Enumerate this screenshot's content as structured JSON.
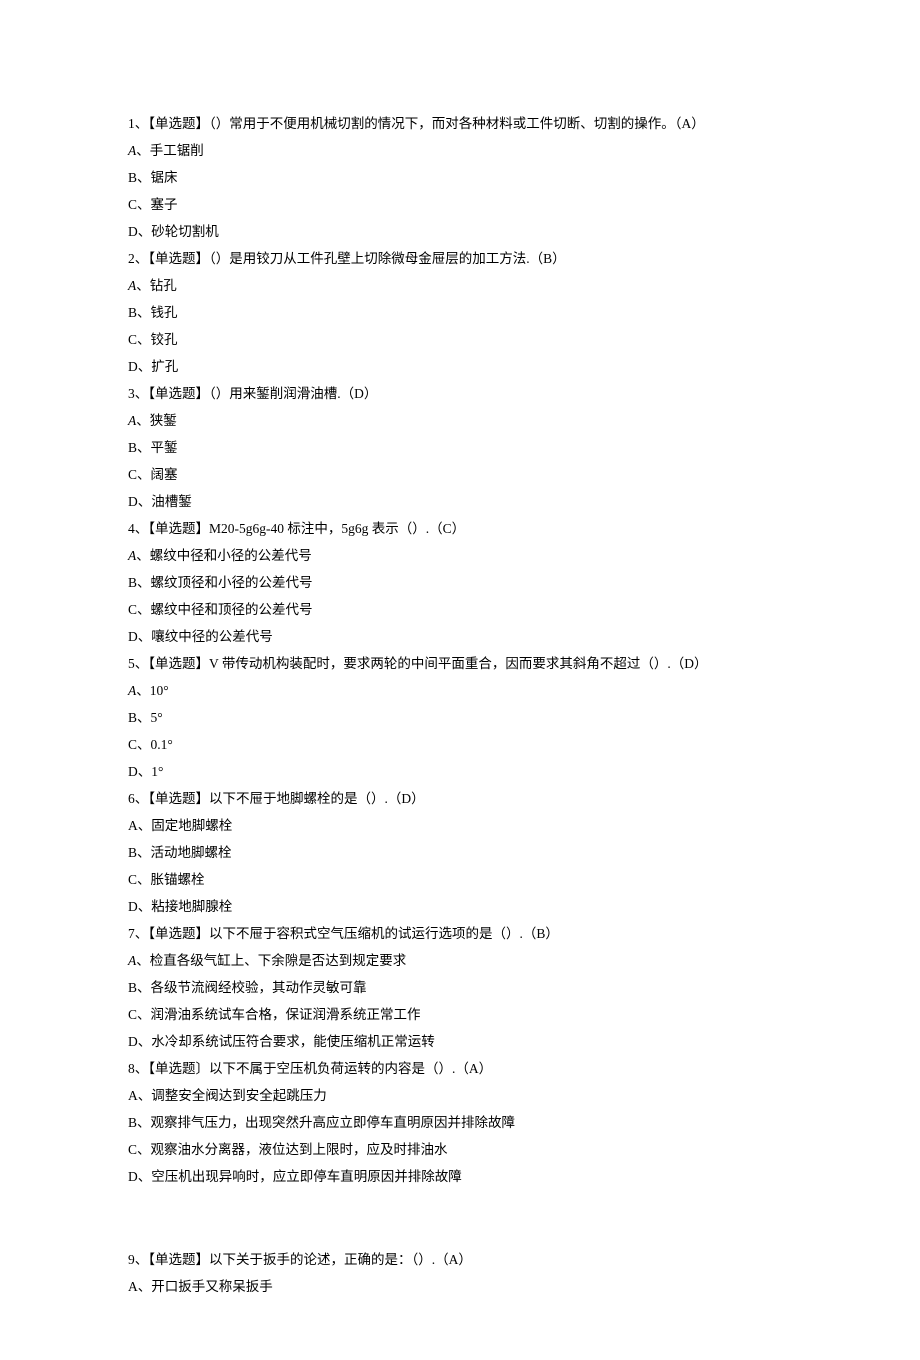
{
  "q1": {
    "stem": "1、【单选题】（）常用于不便用机械切割的情况下，而对各种材料或工件切断、切割的操作。（A）",
    "a": "、手工锯削",
    "b": "B、锯床",
    "c": "C、塞子",
    "d": "D、砂轮切割机"
  },
  "q2": {
    "stem": "2、【单选题】（）是用铰刀从工件孔壁上切除微母金屉层的加工方法.（B）",
    "a": "、钻孔",
    "b": "B、钱孔",
    "c": "C、铰孔",
    "d": "D、扩孔"
  },
  "q3": {
    "stem": "3、【单选题】（）用来錾削润滑油槽.（D）",
    "a": "、狭錾",
    "b": "B、平錾",
    "c": "C、阔塞",
    "d": "D、油槽錾"
  },
  "q4": {
    "stem": "4、【单选题】M20-5g6g-40 标注中，5g6g 表示（）.（C）",
    "a": "、螺纹中径和小径的公差代号",
    "b": "B、螺纹顶径和小径的公差代号",
    "c": "C、螺纹中径和顶径的公差代号",
    "d": "D、嚷纹中径的公差代号"
  },
  "q5": {
    "stem": "5、【单选题】V 带传动机构装配时，要求两轮的中间平面重合，因而要求其斜角不超过（）.（D）",
    "a": "、10°",
    "b": "B、5°",
    "c": "C、0.1°",
    "d": "D、1°"
  },
  "q6": {
    "stem": "6、【单选题】以下不屉于地脚螺栓的是（）.（D）",
    "a": "A、固定地脚螺栓",
    "b": "B、活动地脚螺栓",
    "c": "C、胀锚螺栓",
    "d": "D、粘接地脚腺栓"
  },
  "q7": {
    "stem": "7、【单选题】以下不屉于容积式空气压缩机的试运行选项的是（）.（B）",
    "a": "、检直各级气缸上、下余隙是否达到规定要求",
    "b": "B、各级节流阀经校验，其动作灵敏可靠",
    "c": "C、润滑油系统试车合格，保证润滑系统正常工作",
    "d": "D、水冷却系统试压符合要求，能使压缩机正常运转"
  },
  "q8": {
    "stem": "8、【单选题〕以下不属于空压机负荷运转的内容是（）.（A）",
    "a": "A、调整安全阀达到安全起跳压力",
    "b": "B、观察排气压力，出现突然升高应立即停车直明原因并排除故障",
    "c": "C、观察油水分离器，液位达到上限时，应及时排油水",
    "d": "D、空压机出现异响时，应立即停车直明原因并排除故障"
  },
  "q9": {
    "stem": "9、【单选题】以下关于扳手的论述，正确的是：（）.（A）",
    "a": "A、开口扳手又称呆扳手"
  }
}
